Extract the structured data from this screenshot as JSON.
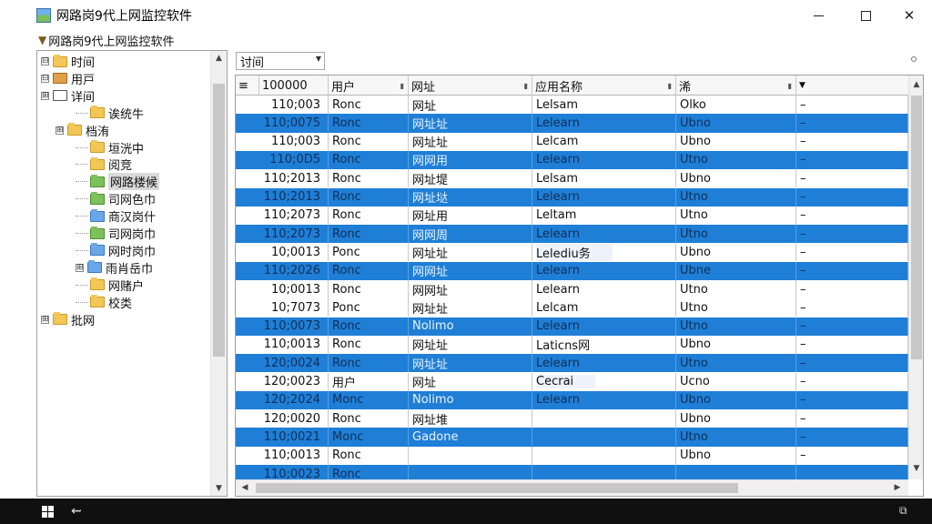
{
  "window": {
    "title": "网路岗9代上网监控软件",
    "menu_label": "网路岗9代上网监控软件",
    "controls": {
      "minimize": "minimize-icon",
      "maximize": "maximize-icon",
      "close": "✕"
    }
  },
  "tree": {
    "nodes": [
      {
        "label": "时间",
        "expander": "⊟",
        "icon": "folder-yellow",
        "level": 0
      },
      {
        "label": "用戸",
        "expander": "⊟",
        "icon": "people-icon",
        "level": 0
      },
      {
        "label": "详间",
        "expander": "⊞",
        "icon": "list-icon",
        "level": 0
      },
      {
        "label": "诶统牛",
        "expander": "",
        "icon": "folder-yellow",
        "level": 2
      },
      {
        "label": "档洧",
        "expander": "⊞",
        "icon": "folder-yellow",
        "level": 1
      },
      {
        "label": "垣洸中",
        "expander": "",
        "icon": "folder-yellow",
        "level": 2
      },
      {
        "label": "阅竞",
        "expander": "",
        "icon": "folder-yellow",
        "level": 2
      },
      {
        "label": "网路楼候",
        "expander": "",
        "icon": "folder-green",
        "level": 2,
        "selected": true
      },
      {
        "label": "司网色巾",
        "expander": "",
        "icon": "folder-green",
        "level": 2
      },
      {
        "label": "商汉岗什",
        "expander": "",
        "icon": "folder-blue",
        "level": 2
      },
      {
        "label": "司网岗巾",
        "expander": "",
        "icon": "folder-green",
        "level": 2
      },
      {
        "label": "网时岗巾",
        "expander": "",
        "icon": "folder-blue",
        "level": 2
      },
      {
        "label": "雨肖岳巾",
        "expander": "⊞",
        "icon": "folder-blue",
        "level": 2
      },
      {
        "label": "网赌户",
        "expander": "",
        "icon": "folder-yellow",
        "level": 2
      },
      {
        "label": "校类",
        "expander": "",
        "icon": "folder-yellow",
        "level": 2
      },
      {
        "label": "批网",
        "expander": "⊞",
        "icon": "folder-yellow",
        "level": 0
      }
    ]
  },
  "filter": {
    "combo_value": "讨间"
  },
  "grid": {
    "columns": [
      "100000",
      "用户",
      "网址",
      "应用名称",
      "浠",
      ""
    ],
    "header_icon": "≡",
    "rows": [
      {
        "id": "110;003",
        "user": "Ronc",
        "url": "网址",
        "app": "Lelsam",
        "extra": "Olko",
        "dash": "–",
        "selected": false
      },
      {
        "id": "110;0075",
        "user": "Ronc",
        "url": "网址址",
        "app": "Lelearn",
        "extra": "Ubno",
        "dash": "–",
        "selected": true
      },
      {
        "id": "110;003",
        "user": "Ronc",
        "url": "网址址",
        "app": "Lelcam",
        "extra": "Ubno",
        "dash": "–",
        "selected": false
      },
      {
        "id": "110;0D5",
        "user": "Ronc",
        "url": "网网用",
        "app": "Lelearn",
        "extra": "Utno",
        "dash": "–",
        "selected": true
      },
      {
        "id": "110;2013",
        "user": "Ronc",
        "url": "网址堤",
        "app": "Lelsam",
        "extra": "Ubno",
        "dash": "–",
        "selected": false
      },
      {
        "id": "110;2013",
        "user": "Ronc",
        "url": "网址垯",
        "app": "Lelearn",
        "extra": "Utno",
        "dash": "–",
        "selected": true
      },
      {
        "id": "110;2073",
        "user": "Ronc",
        "url": "网址用",
        "app": "Leltam",
        "extra": "Utno",
        "dash": "–",
        "selected": false
      },
      {
        "id": "110;2073",
        "user": "Ronc",
        "url": "网网周",
        "app": "Lelearn",
        "extra": "Utno",
        "dash": "–",
        "selected": true
      },
      {
        "id": "10;0013",
        "user": "Ponc",
        "url": "网址址",
        "app": "Lelediu务",
        "extra": "Ubno",
        "dash": "–",
        "selected": false,
        "app_highlight": true
      },
      {
        "id": "110;2026",
        "user": "Ronc",
        "url": "网网址",
        "app": "Lelearn",
        "extra": "Ubne",
        "dash": "–",
        "selected": true
      },
      {
        "id": "10;0013",
        "user": "Ronc",
        "url": "网网址",
        "app": "Lelearn",
        "extra": "Utno",
        "dash": "–",
        "selected": false
      },
      {
        "id": "10;7073",
        "user": "Ponc",
        "url": "网址址",
        "app": "Lelcam",
        "extra": "Utno",
        "dash": "–",
        "selected": false
      },
      {
        "id": "110;0073",
        "user": "Ronc",
        "url": "Nolimo",
        "app": "Lelearn",
        "extra": "Utno",
        "dash": "–",
        "selected": true
      },
      {
        "id": "110;0013",
        "user": "Ronc",
        "url": "网址址",
        "app": "Laticns网",
        "extra": "Ubno",
        "dash": "–",
        "selected": false
      },
      {
        "id": "120;0024",
        "user": "Ronc",
        "url": "网址址",
        "app": "Lelearn",
        "extra": "Utno",
        "dash": "–",
        "selected": true
      },
      {
        "id": "120;0023",
        "user": "用户",
        "url": "网址",
        "app": "Cecrai",
        "extra": "Ucno",
        "dash": "–",
        "selected": false,
        "app_highlight": true
      },
      {
        "id": "120;2024",
        "user": "Monc",
        "url": "Nolimo",
        "app": "Lelearn",
        "extra": "Ubno",
        "dash": "–",
        "selected": true
      },
      {
        "id": "120;0020",
        "user": "Ronc",
        "url": "网址堆",
        "app": "",
        "extra": "Ubno",
        "dash": "–",
        "selected": false
      },
      {
        "id": "110;0021",
        "user": "Monc",
        "url": "Gadone",
        "app": "",
        "extra": "Utno",
        "dash": "–",
        "selected": true
      },
      {
        "id": "110;0013",
        "user": "Ronc",
        "url": "",
        "app": "",
        "extra": "Ubno",
        "dash": "–",
        "selected": false
      },
      {
        "id": "110;0023",
        "user": "Ronc",
        "url": "",
        "app": "",
        "extra": "",
        "dash": "",
        "selected": true
      }
    ]
  },
  "taskbar": {
    "start": "windows-logo",
    "app_icon": "⇜",
    "tray_icon": "⧉"
  }
}
